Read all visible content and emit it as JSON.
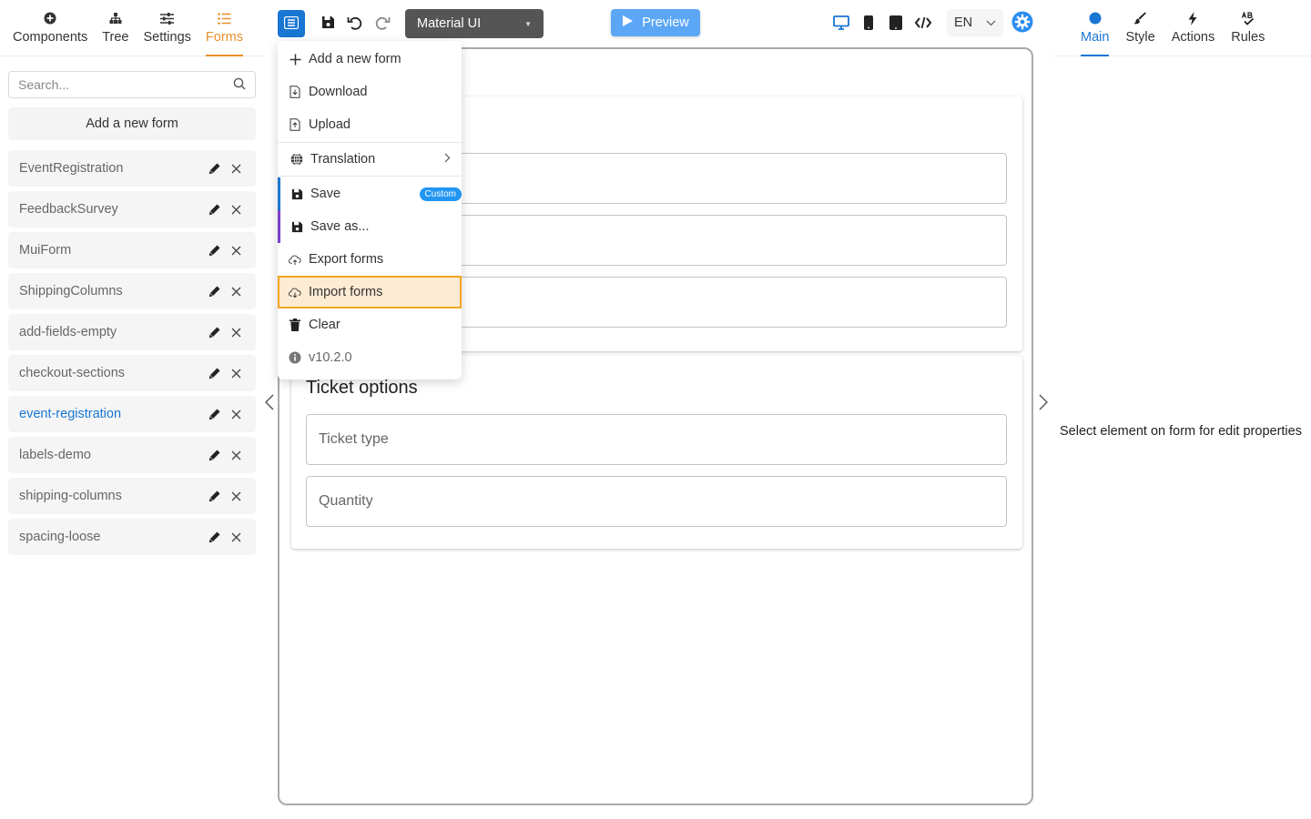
{
  "left_tabs": [
    {
      "label": "Components",
      "icon": "plus-circle-icon"
    },
    {
      "label": "Tree",
      "icon": "tree-icon"
    },
    {
      "label": "Settings",
      "icon": "sliders-icon"
    },
    {
      "label": "Forms",
      "icon": "list-icon",
      "active": true
    }
  ],
  "search": {
    "placeholder": "Search..."
  },
  "add_form_label": "Add a new form",
  "forms": [
    "EventRegistration",
    "FeedbackSurvey",
    "MuiForm",
    "ShippingColumns",
    "add-fields-empty",
    "checkout-sections",
    "event-registration",
    "labels-demo",
    "shipping-columns",
    "spacing-loose"
  ],
  "current_form": "event-registration",
  "toolbar": {
    "theme": "Material UI",
    "preview_label": "Preview",
    "language": "EN"
  },
  "menu": {
    "add_new": "Add a new form",
    "download": "Download",
    "upload": "Upload",
    "translation": "Translation",
    "save": "Save",
    "save_badge": "Custom",
    "save_as": "Save as...",
    "export": "Export forms",
    "import": "Import forms",
    "clear": "Clear",
    "version": "v10.2.0"
  },
  "canvas": {
    "section2_title": "Ticket options",
    "field_ticket_type": "Ticket type",
    "field_quantity": "Quantity"
  },
  "right_tabs": [
    {
      "label": "Main",
      "icon": "circle-icon",
      "active": true
    },
    {
      "label": "Style",
      "icon": "brush-icon"
    },
    {
      "label": "Actions",
      "icon": "lightning-icon"
    },
    {
      "label": "Rules",
      "icon": "rules-icon"
    }
  ],
  "props_hint": "Select element on form for edit properties",
  "colors": {
    "accent_blue": "#1976d2",
    "forms_tab_orange": "#e8902b",
    "highlight_border": "#f5a623",
    "preview_blue": "#5ba7f5"
  }
}
